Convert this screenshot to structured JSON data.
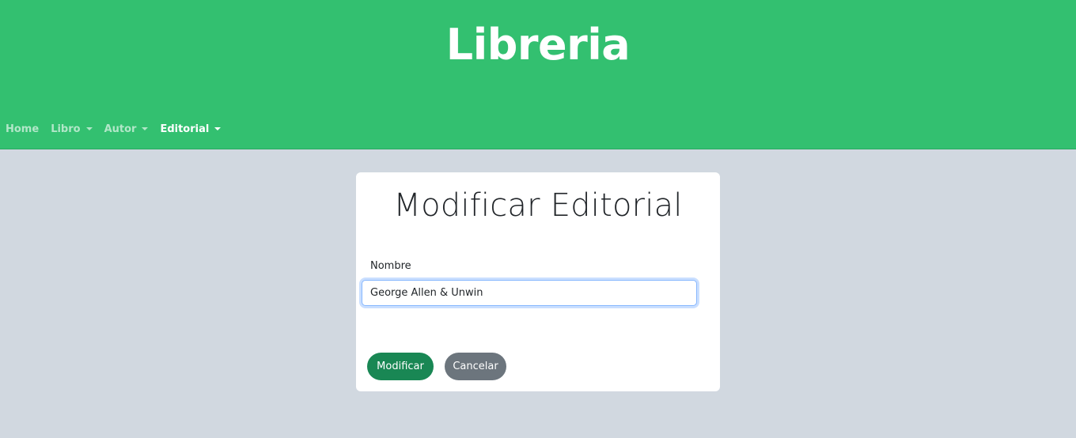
{
  "header": {
    "title": "Libreria"
  },
  "nav": {
    "items": [
      {
        "label": "Home",
        "dropdown": false,
        "active": false
      },
      {
        "label": "Libro",
        "dropdown": true,
        "active": false
      },
      {
        "label": "Autor",
        "dropdown": true,
        "active": false
      },
      {
        "label": "Editorial",
        "dropdown": true,
        "active": true
      }
    ]
  },
  "form": {
    "title": "Modificar Editorial",
    "name_label": "Nombre",
    "name_value": "George Allen & Unwin",
    "submit_label": "Modificar",
    "cancel_label": "Cancelar"
  },
  "colors": {
    "header_bg": "#33c070",
    "page_bg": "#d1d8e0",
    "submit_bg": "#198754",
    "cancel_bg": "#6c757d",
    "input_focus": "#86b7fe"
  },
  "icons": {
    "dropdown": "caret-down-icon"
  }
}
